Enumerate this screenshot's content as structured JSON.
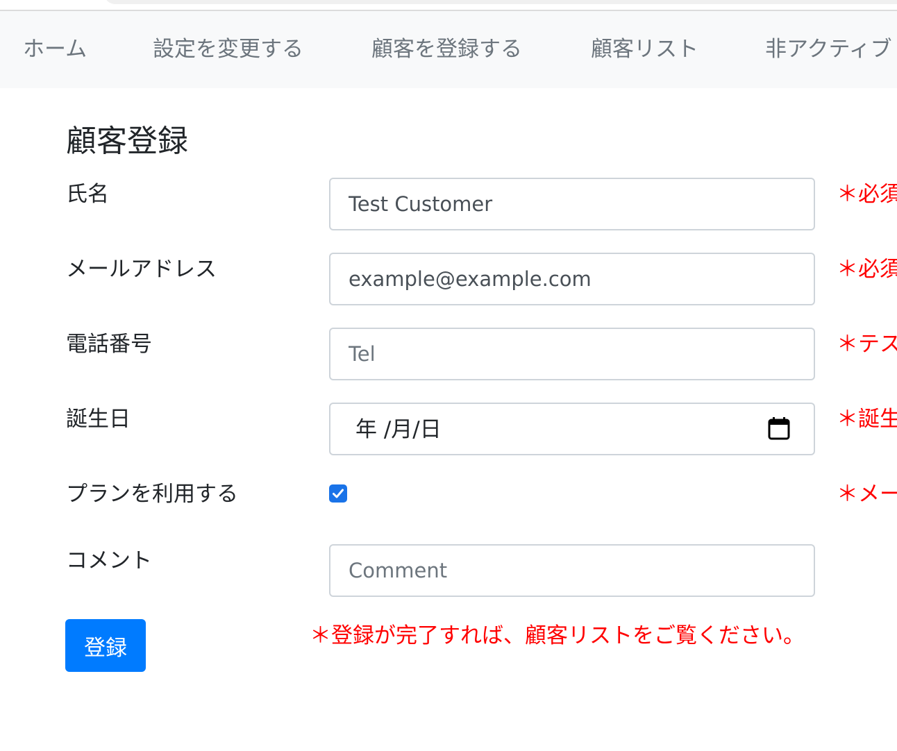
{
  "nav": {
    "items": [
      {
        "label": "ホーム"
      },
      {
        "label": "設定を変更する"
      },
      {
        "label": "顧客を登録する"
      },
      {
        "label": "顧客リスト"
      },
      {
        "label": "非アクティブ"
      }
    ]
  },
  "form": {
    "title": "顧客登録",
    "name": {
      "label": "氏名",
      "value": "Test Customer",
      "note": "＊必須"
    },
    "email": {
      "label": "メールアドレス",
      "value": "example@example.com",
      "note": "＊必須"
    },
    "tel": {
      "label": "電話番号",
      "placeholder": "Tel",
      "value": "",
      "note": "＊テス"
    },
    "birthday": {
      "label": "誕生日",
      "value": "年 /月/日",
      "note": "＊誕生"
    },
    "plan": {
      "label": "プランを利用する",
      "checked": true,
      "note": "＊メー"
    },
    "comment": {
      "label": "コメント",
      "placeholder": "Comment",
      "value": ""
    },
    "submit_label": "登録",
    "bottom_note": "＊登録が完了すれば、顧客リストをご覧ください。"
  },
  "colors": {
    "accent": "#007bff",
    "note": "#ff0000",
    "nav_bg": "#f8f9fa",
    "nav_text": "#6c757d"
  }
}
